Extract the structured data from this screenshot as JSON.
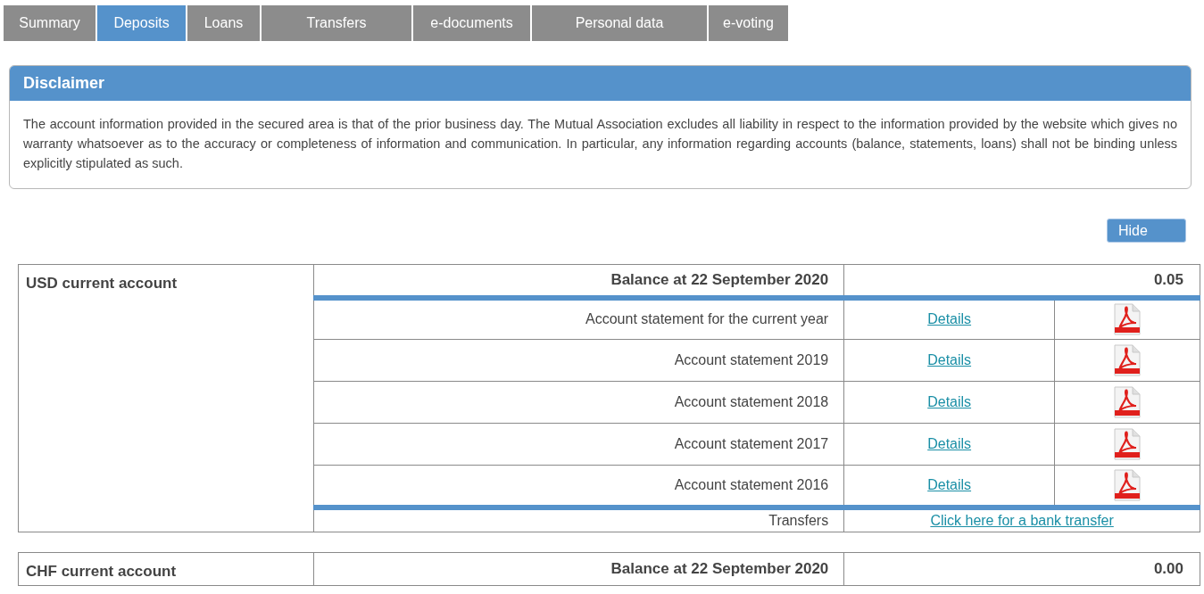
{
  "tabs": [
    {
      "label": "Summary",
      "selected": false
    },
    {
      "label": "Deposits",
      "selected": true
    },
    {
      "label": "Loans",
      "selected": false
    },
    {
      "label": "Transfers",
      "selected": false
    },
    {
      "label": "e-documents",
      "selected": false
    },
    {
      "label": "Personal data",
      "selected": false
    },
    {
      "label": "e-voting",
      "selected": false
    }
  ],
  "disclaimer": {
    "title": "Disclaimer",
    "text": "The account information provided in the secured area is that of the prior business day. The Mutual Association excludes all liability in respect to the information provided by the website which gives no warranty whatsoever as to the accuracy or completeness of information and communication. In particular, any information regarding accounts (balance, statements, loans) shall not be binding unless explicitly stipulated as such."
  },
  "hide_button": "Hide",
  "accounts": [
    {
      "name": "USD current account",
      "balance_label": "Balance at 22 September 2020",
      "balance": "0.05",
      "statements": [
        {
          "label": "Account statement for the current year",
          "link": "Details"
        },
        {
          "label": "Account statement 2019",
          "link": "Details"
        },
        {
          "label": "Account statement 2018",
          "link": "Details"
        },
        {
          "label": "Account statement 2017",
          "link": "Details"
        },
        {
          "label": "Account statement 2016",
          "link": "Details"
        }
      ],
      "transfer_label": "Transfers",
      "transfer_link": "Click here for a bank transfer"
    },
    {
      "name": "CHF current account",
      "balance_label": "Balance at 22 September 2020",
      "balance": "0.00"
    }
  ]
}
